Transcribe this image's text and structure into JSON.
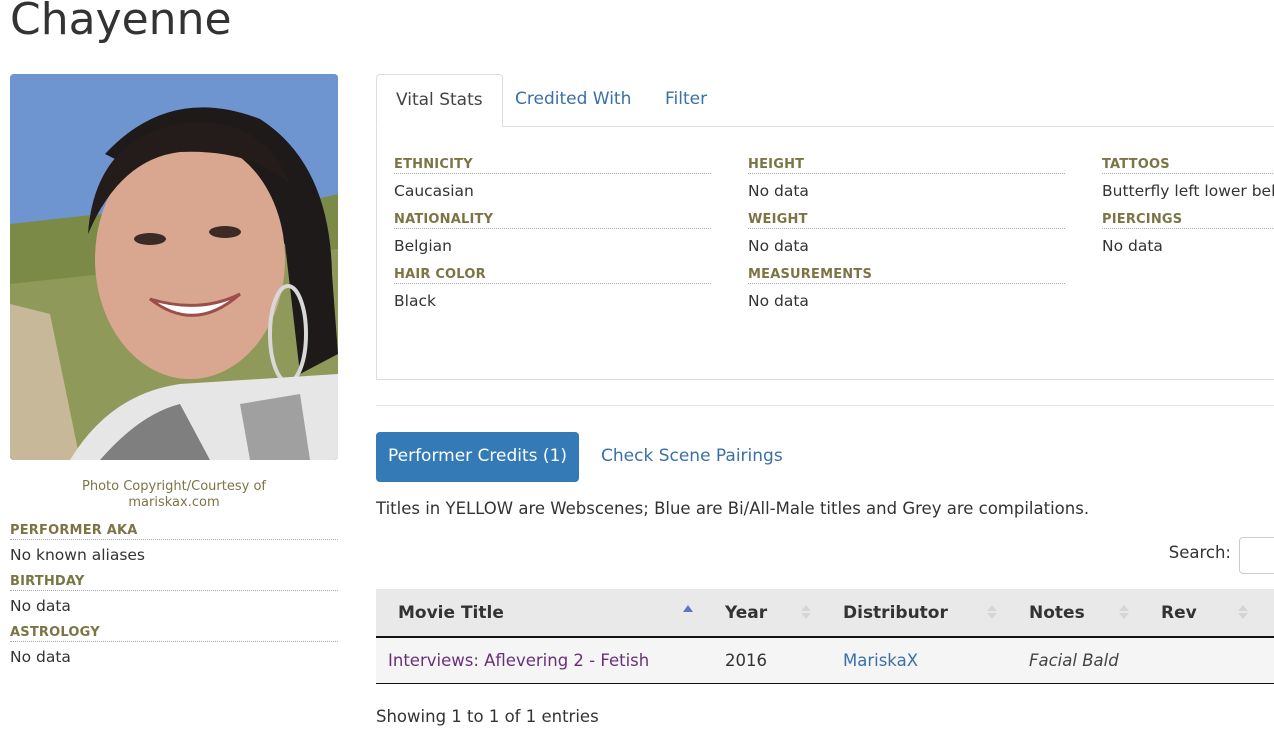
{
  "page": {
    "title": "Chayenne"
  },
  "photo": {
    "caption": "Photo Copyright/Courtesy of mariskax.com"
  },
  "left_stats": [
    {
      "label": "Performer AKA",
      "value": "No known aliases"
    },
    {
      "label": "Birthday",
      "value": "No data"
    },
    {
      "label": "Astrology",
      "value": "No data"
    }
  ],
  "tabs": [
    {
      "label": "Vital Stats",
      "active": true
    },
    {
      "label": "Credited With",
      "active": false
    },
    {
      "label": "Filter",
      "active": false
    }
  ],
  "vital_stats": {
    "col1": [
      {
        "label": "Ethnicity",
        "value": "Caucasian"
      },
      {
        "label": "Nationality",
        "value": "Belgian"
      },
      {
        "label": "Hair Color",
        "value": "Black"
      }
    ],
    "col2": [
      {
        "label": "Height",
        "value": "No data"
      },
      {
        "label": "Weight",
        "value": "No data"
      },
      {
        "label": "Measurements",
        "value": "No data"
      }
    ],
    "col3": [
      {
        "label": "Tattoos",
        "value": "Butterfly left lower belly"
      },
      {
        "label": "Piercings",
        "value": "No data"
      }
    ]
  },
  "credits": {
    "button_label": "Performer Credits (1)",
    "pairings_label": "Check Scene Pairings",
    "legend_note": "Titles in YELLOW are Webscenes; Blue are Bi/All-Male titles and Grey are compilations.",
    "search_label": "Search:",
    "search_value": "",
    "columns": [
      "Movie Title",
      "Year",
      "Distributor",
      "Notes",
      "Rev"
    ],
    "rows": [
      {
        "title": "Interviews: Aflevering 2 - Fetish",
        "year": "2016",
        "distributor": "MariskaX",
        "notes": "Facial Bald",
        "rev": ""
      }
    ],
    "showing": "Showing 1 to 1 of 1 entries"
  },
  "colors": {
    "accent": "#337ab7",
    "link": "#3a6fa8",
    "label": "#7b7546",
    "visited": "#6b2f78"
  }
}
